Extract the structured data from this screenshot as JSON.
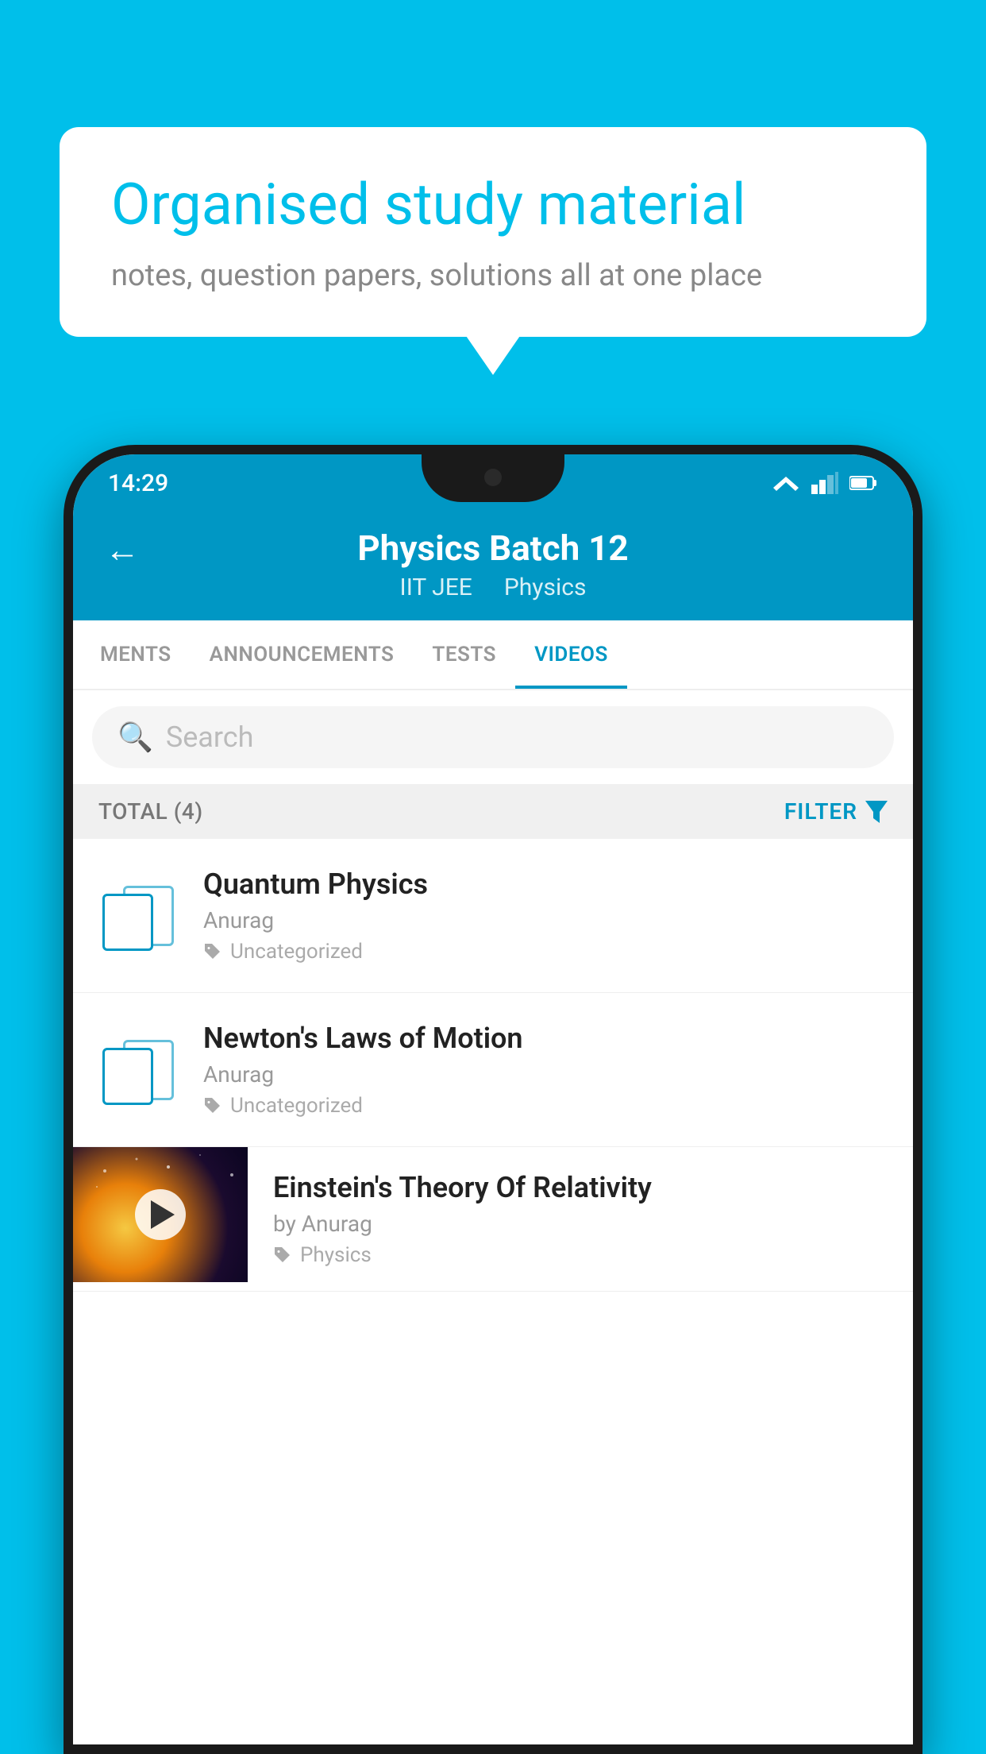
{
  "background_color": "#00BFEA",
  "speech_bubble": {
    "title": "Organised study material",
    "subtitle": "notes, question papers, solutions all at one place"
  },
  "status_bar": {
    "time": "14:29",
    "colors": {
      "background": "#0097C4"
    }
  },
  "app_header": {
    "title": "Physics Batch 12",
    "subtitle_left": "IIT JEE",
    "subtitle_right": "Physics",
    "back_label": "←"
  },
  "tabs": [
    {
      "label": "MENTS",
      "active": false
    },
    {
      "label": "ANNOUNCEMENTS",
      "active": false
    },
    {
      "label": "TESTS",
      "active": false
    },
    {
      "label": "VIDEOS",
      "active": true
    }
  ],
  "search": {
    "placeholder": "Search"
  },
  "filter_bar": {
    "total_label": "TOTAL (4)",
    "filter_label": "FILTER"
  },
  "videos": [
    {
      "title": "Quantum Physics",
      "author": "Anurag",
      "tag": "Uncategorized",
      "has_thumbnail": false
    },
    {
      "title": "Newton's Laws of Motion",
      "author": "Anurag",
      "tag": "Uncategorized",
      "has_thumbnail": false
    },
    {
      "title": "Einstein's Theory Of Relativity",
      "author": "by Anurag",
      "tag": "Physics",
      "has_thumbnail": true
    }
  ]
}
